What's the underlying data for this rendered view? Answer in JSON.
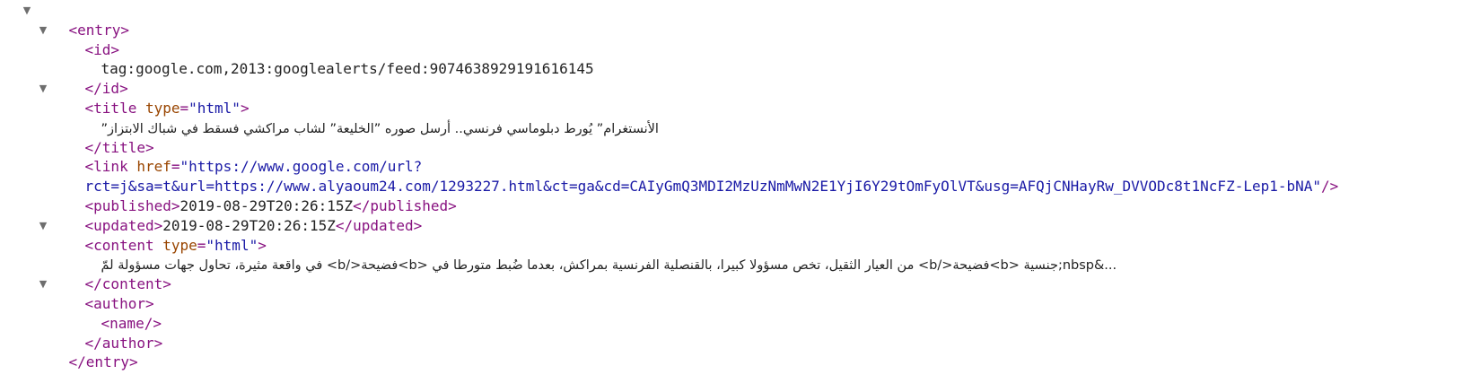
{
  "tokens": {
    "entry_open": "<entry>",
    "entry_close": "</entry>",
    "id_open": "<id>",
    "id_close": "</id>",
    "title_open_start": "<title",
    "title_close": "</title>",
    "link_open_start": "<link",
    "published_open": "<published>",
    "published_close": "</published>",
    "updated_open": "<updated>",
    "updated_close": "</updated>",
    "content_open_start": "<content",
    "content_close": "</content>",
    "author_open": "<author>",
    "author_close": "</author>",
    "name_selfclose": "<name/>",
    "attr_type": "type",
    "attr_href": "href",
    "eq": "=",
    "gt": ">",
    "selfclose_end": "/>",
    "space": " "
  },
  "toggle_icon": "triangle-down",
  "toggle_glyph": "▼",
  "entry": {
    "id": "tag:google.com,2013:googlealerts/feed:9074638929191616145",
    "title": {
      "type_value": "\"html\"",
      "text": "الأنستغرام” يُورط دبلوماسي فرنسي.. أرسل صوره ”الخليعة” لشاب مراكشي فسقط في شباك الابتزاز”"
    },
    "link": {
      "href_part1": "\"https://www.google.com/url?",
      "href_part2": "rct=j&sa=t&url=https://www.alyaoum24.com/1293227.html&ct=ga&cd=CAIyGmQ3MDI2MzUzNmMwN2E1YjI6Y29tOmFyOlVT&usg=AFQjCNHayRw_DVVODc8t1NcFZ-Lep1-bNA\""
    },
    "published": "2019-08-29T20:26:15Z",
    "updated": "2019-08-29T20:26:15Z",
    "content": {
      "type_value": "\"html\"",
      "text": "...&nbsp;جنسية <b>فضيحة</b> من العيار الثقيل، تخص مسؤولا كبيرا، بالقنصلية الفرنسية بمراكش، بعدما ضُبط متورطا في <b>فضيحة</b> في واقعة مثيرة، تحاول جهات مسؤولة لمّ"
    }
  }
}
